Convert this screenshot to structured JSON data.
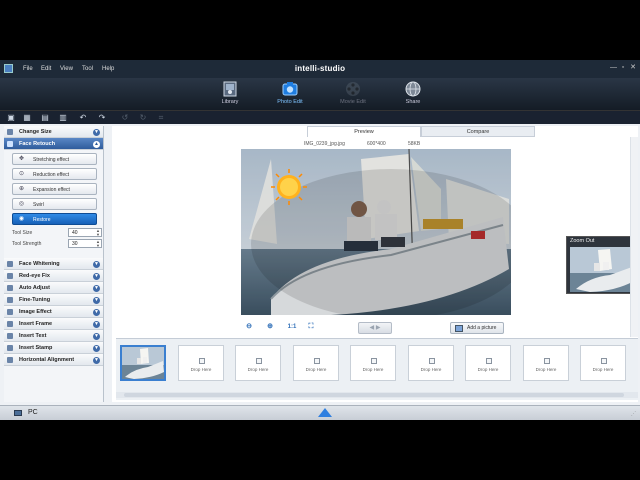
{
  "window": {
    "title": "intelli-studio",
    "min": "—",
    "max": "▫",
    "close": "✕"
  },
  "menu": [
    "File",
    "Edit",
    "View",
    "Tool",
    "Help"
  ],
  "modes": [
    {
      "label": "Library",
      "icon": "library-icon",
      "state": "normal"
    },
    {
      "label": "Photo Edit",
      "icon": "photo-edit-icon",
      "state": "active"
    },
    {
      "label": "Movie Edit",
      "icon": "movie-edit-icon",
      "state": "disabled"
    },
    {
      "label": "Share",
      "icon": "share-globe-icon",
      "state": "normal"
    }
  ],
  "toolbar": {
    "undo": "↶",
    "redo": "↷"
  },
  "left_panel": {
    "sections_top": [
      {
        "label": "Change Size",
        "icon": "change-size-icon"
      },
      {
        "label": "Face Retouch",
        "icon": "face-retouch-icon",
        "active": true
      }
    ],
    "effects": [
      {
        "label": "Stretching effect",
        "icon": "stretch-icon"
      },
      {
        "label": "Reduction effect",
        "icon": "reduction-icon"
      },
      {
        "label": "Expansion effect",
        "icon": "expansion-icon"
      },
      {
        "label": "Swirl",
        "icon": "swirl-icon"
      },
      {
        "label": "Restore",
        "icon": "restore-icon",
        "selected": true
      }
    ],
    "tool_size": {
      "label": "Tool Size",
      "value": "40"
    },
    "tool_strength": {
      "label": "Tool Strength",
      "value": "30"
    },
    "sections_bottom": [
      {
        "label": "Face Whitening",
        "icon": "face-whitening-icon"
      },
      {
        "label": "Red-eye Fix",
        "icon": "red-eye-icon"
      },
      {
        "label": "Auto Adjust",
        "icon": "auto-adjust-icon"
      },
      {
        "label": "Fine-Tuning",
        "icon": "fine-tuning-icon"
      },
      {
        "label": "Image Effect",
        "icon": "image-effect-icon"
      },
      {
        "label": "Insert Frame",
        "icon": "insert-frame-icon"
      },
      {
        "label": "Insert Text",
        "icon": "insert-text-icon"
      },
      {
        "label": "Insert Stamp",
        "icon": "insert-stamp-icon"
      },
      {
        "label": "Horizontal Alignment",
        "icon": "horizontal-alignment-icon"
      }
    ]
  },
  "tabs": {
    "preview": "Preview",
    "compare": "Compare"
  },
  "file_info": {
    "name": "IMG_0239_jpg.jpg",
    "dimensions": "600*400",
    "size": "58KB"
  },
  "zoom_out": {
    "label": "Zoom Out"
  },
  "view_tools": {
    "zoom_out": "⊖",
    "zoom_in": "⊕",
    "actual": "1:1",
    "fit": "⛶"
  },
  "nav": {
    "prev": "◀",
    "next": "▶"
  },
  "add_picture": {
    "label": "Add a picture"
  },
  "tray": {
    "drop_label": "Drop Here",
    "slots": 8
  },
  "statusbar": {
    "label": "PC"
  },
  "colors": {
    "accent": "#2f7fe0",
    "active_section": "#2f5c9c",
    "dark_chrome": "#1e2a38"
  }
}
